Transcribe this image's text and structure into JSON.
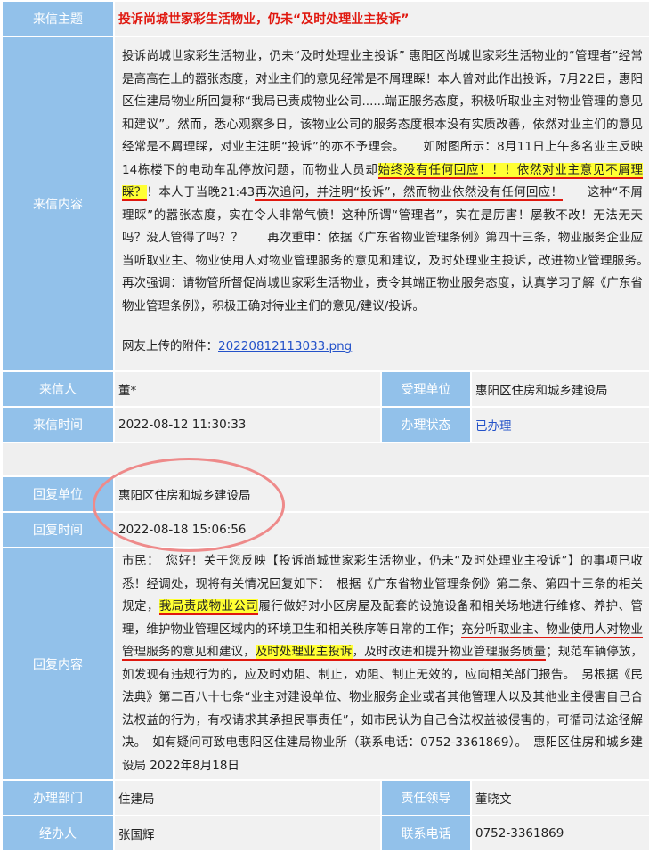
{
  "labels": {
    "subject": "来信主题",
    "content": "来信内容",
    "sender": "来信人",
    "received_unit": "受理单位",
    "letter_time": "来信时间",
    "status": "办理状态",
    "reply_unit": "回复单位",
    "reply_time": "回复时间",
    "reply_content": "回复内容",
    "dept": "办理部门",
    "leader": "责任领导",
    "handler": "经办人",
    "phone": "联系电话"
  },
  "letter": {
    "subject": "投诉尚城世家彩生活物业，仍未“及时处理业主投诉”",
    "content": {
      "p1": "投诉尚城世家彩生活物业，仍未“及时处理业主投诉” 惠阳区尚城世家彩生活物业的“管理者”经常是高高在上的嚣张态度，对业主们的意见经常是不屑理睬！本人曾对此作出投诉，7月22日，惠阳区住建局物业所回复称“我局已责成物业公司......端正服务态度，积极听取业主对物业管理的意见和建议”。然而，悉心观察多日，该物业公司的服务态度根本没有实质改善，依然对业主们的意见经常是不屑理睬，对业主注明“投诉”的亦不予理会。　　如附图所示：8月11日上午多名业主反映14栋楼下的电动车乱停放问题，而物业人员却",
      "h1": "始终没有任何回应！！！依然对业主意见不屑理睬？",
      "p2": "！本人于当晚21:43",
      "u1": "再次追问，",
      "u2": "并注明“投诉”，然而物业依然没有任何回应！",
      "p3": "　　这种“不屑理睬”的嚣张态度，实在令人非常气愤！这种所谓“管理者”，实在是厉害！屡教不改！无法无天吗？没人管得了吗？？　　再次重申：依据《广东省物业管理条例》第四十三条，物业服务企业应当听取业主、物业使用人对物业管理服务的意见和建议，及时处理业主投诉，改进物业管理服务。　　再次强调：请物管所督促尚城世家彩生活物业，责令其端正物业服务态度，认真学习了解《广东省物业管理条例》，积极正确对待业主们的意见/建议/投诉。"
    },
    "attachment_label": "网友上传的附件：",
    "attachment_file": "20220812113033.png",
    "sender": "董*",
    "received_unit": "惠阳区住房和城乡建设局",
    "time": "2022-08-12 11:30:33",
    "status": "已办理"
  },
  "reply": {
    "unit": "惠阳区住房和城乡建设局",
    "time": "2022-08-18 15:06:56",
    "content": {
      "p1": "市民：　您好！关于您反映【投诉尚城世家彩生活物业，仍未“及时处理业主投诉”】的事项已收悉！经调处，现将有关情况回复如下：　根据《广东省物业管理条例》第二条、第四十三条的相关规定，",
      "h1": "我局责成物业公司",
      "p2": "履行做好对小区房屋及配套的设施设备和相关场地进行维修、养护、管理，维护物业管理区域内的环境卫生和相关秩序等日常的工作；",
      "u1": "充分听取业主、物业使用人对物业管理服务的意见和建议，",
      "h2": "及时处理业主投诉",
      "u2": "，及时改进和提升物业管理服务质量",
      "p3": "；规范车辆停放，如发现有违规行为的，应及时劝阻、制止，劝阻、制止无效的，应向相关部门报告。　另根据《民法典》第二百八十七条“业主对建设单位、物业服务企业或者其他管理人以及其他业主侵害自己合法权益的行为，有权请求其承担民事责任”，如市民认为自己合法权益被侵害的，可循司法途径解决。　如有疑问可致电惠阳区住建局物业所（联系电话：0752-3361869）。　惠阳区住房和城乡建设局 2022年8月18日"
    },
    "dept": "住建局",
    "leader": "董晓文",
    "handler": "张国辉",
    "phone": "0752-3361869"
  },
  "colors": {
    "label_bg": "#92c1ea",
    "value_bg": "#f1f1f1",
    "title_red": "#e0180f",
    "highlight": "#ffff33",
    "link_blue": "#2452c9",
    "circle": "#ee8a8a"
  }
}
